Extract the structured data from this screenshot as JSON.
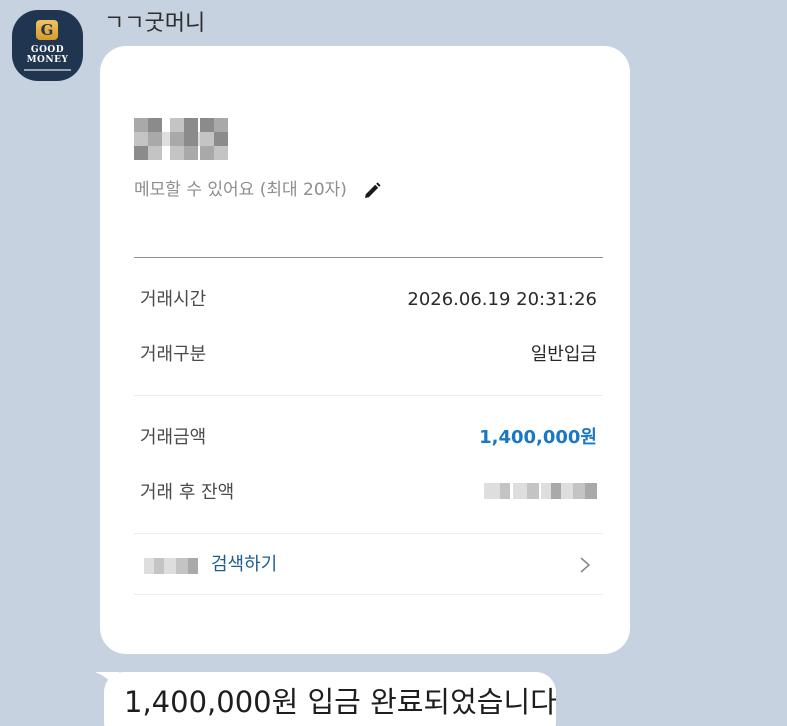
{
  "chat": {
    "sender_name": "ㄱㄱ굿머니",
    "avatar": {
      "logo_letter": "G",
      "word1": "GOOD",
      "word2": "MONEY"
    },
    "message_text": "1,400,000원 입금 완료되었습니다"
  },
  "card": {
    "memo_placeholder": "메모할 수 있어요 (최대 20자)",
    "memo_icon": "pencil-icon",
    "rows": [
      {
        "label": "거래시간",
        "value": "2026.06.19 20:31:26"
      },
      {
        "label": "거래구분",
        "value": "일반입금"
      },
      {
        "label": "거래금액",
        "value": "1,400,000원"
      },
      {
        "label": "거래 후 잔액",
        "value": ""
      }
    ],
    "search_label": "검색하기",
    "chevron_icon": "chevron-right-icon"
  },
  "colors": {
    "background": "#c6d2df",
    "amount_accent": "#1a78c2",
    "link_accent": "#1e5d94"
  }
}
